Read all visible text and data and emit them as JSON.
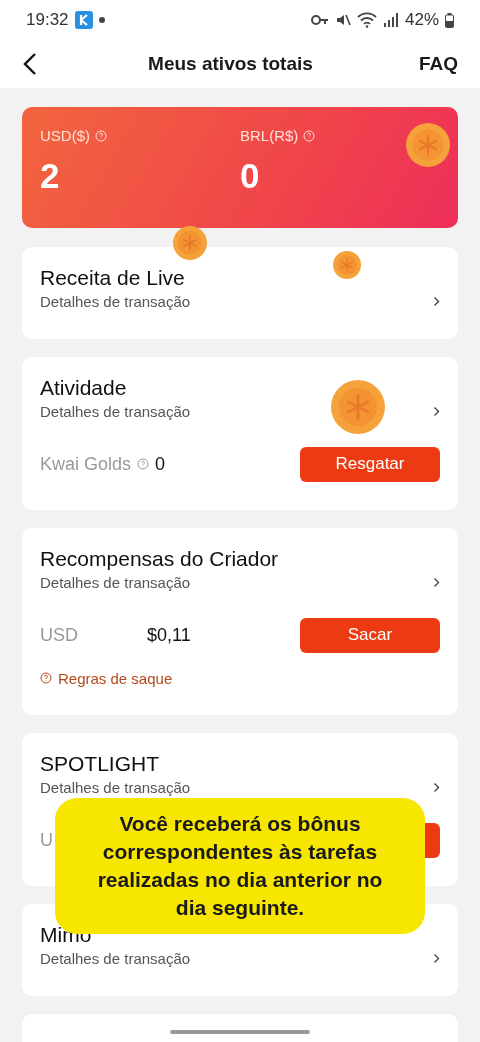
{
  "status_bar": {
    "time": "19:32",
    "battery": "42%"
  },
  "header": {
    "title": "Meus ativos totais",
    "faq": "FAQ"
  },
  "balances": [
    {
      "label": "USD($)",
      "value": "2"
    },
    {
      "label": "BRL(R$)",
      "value": "0"
    }
  ],
  "cards": [
    {
      "kind": "plain",
      "title": "Receita de Live",
      "subtitle": "Detalhes de transação"
    },
    {
      "kind": "action",
      "title": "Atividade",
      "subtitle": "Detalhes de transação",
      "label": "Kwai Golds",
      "help": true,
      "amount": "0",
      "button": "Resgatar"
    },
    {
      "kind": "action",
      "title": "Recompensas do Criador",
      "subtitle": "Detalhes de transação",
      "label": "USD",
      "help": false,
      "amount": "$0,11",
      "button": "Sacar",
      "rules": "Regras de saque"
    },
    {
      "kind": "action",
      "title": "SPOTLIGHT",
      "subtitle": "Detalhes de transação",
      "label": "U"
    },
    {
      "kind": "plain",
      "title": "Mimo",
      "subtitle": "Detalhes de transação"
    },
    {
      "kind": "empty"
    }
  ],
  "caption": "Você receberá os bônus correspondentes às tarefas realizadas no dia anterior no dia seguinte."
}
